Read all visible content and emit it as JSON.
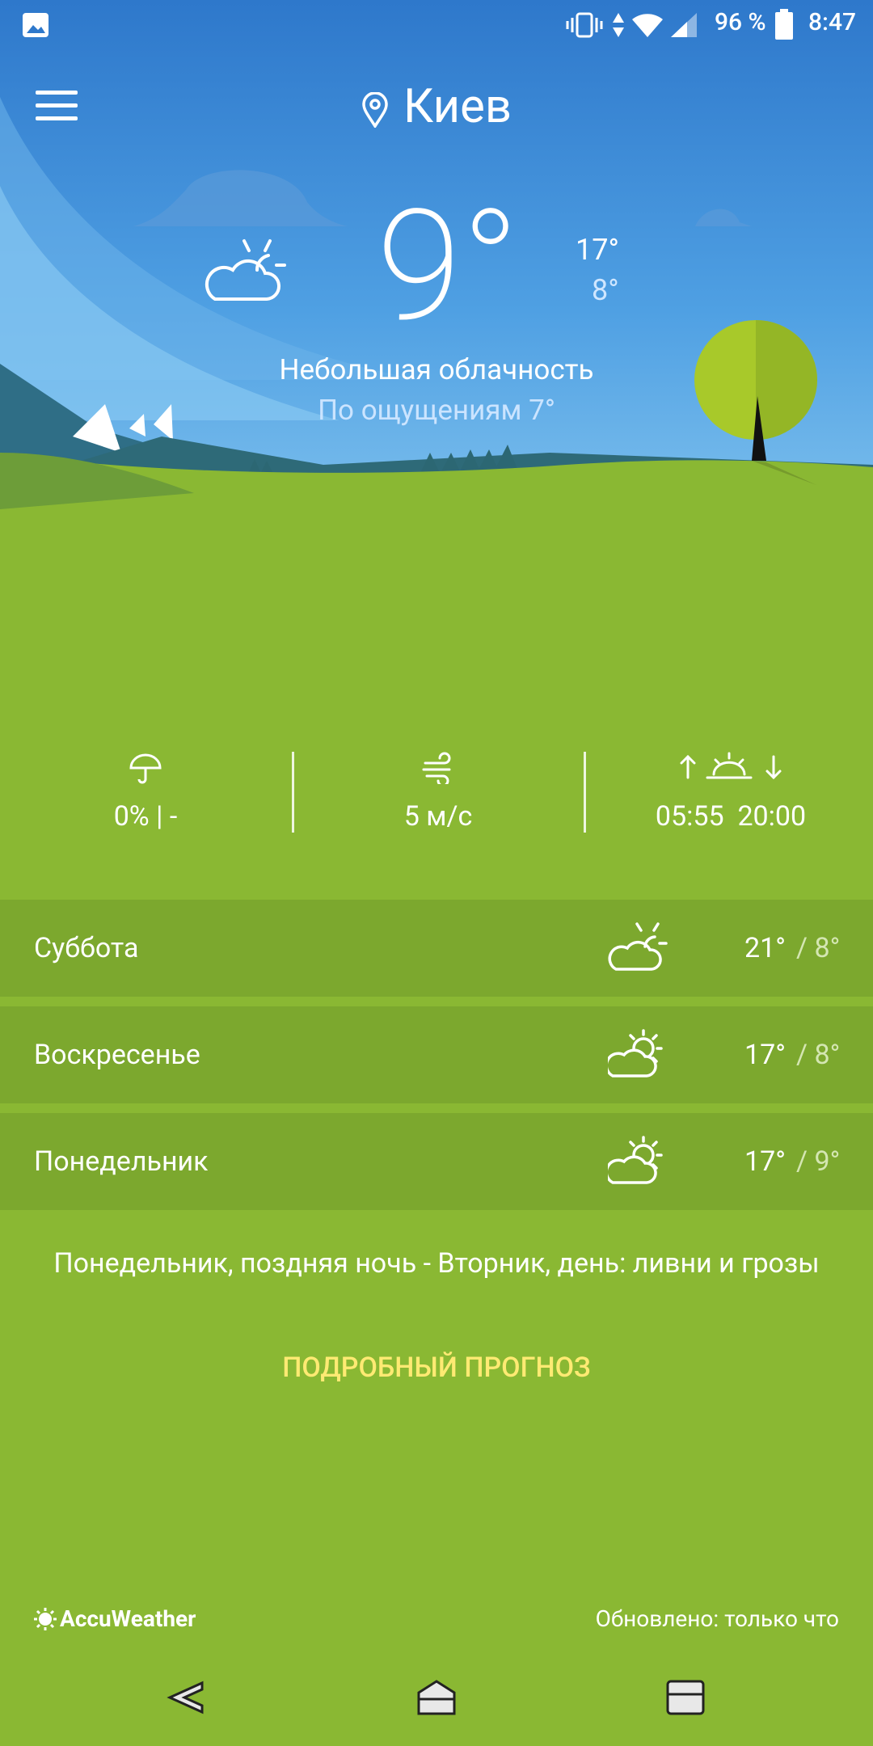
{
  "status_bar": {
    "battery_percent": "96 %",
    "time": "8:47"
  },
  "header": {
    "city": "Киев"
  },
  "current": {
    "temperature": "9°",
    "high": "17°",
    "low": "8°",
    "condition": "Небольшая облачность",
    "feels_like": "По ощущениям 7°"
  },
  "stats": {
    "precipitation": "0% | -",
    "wind": "5 м/с",
    "sunrise": "05:55",
    "sunset": "20:00"
  },
  "forecast": [
    {
      "day": "Суббота",
      "high": "21°",
      "low": " / 8°",
      "icon": "cloud-sun-icon"
    },
    {
      "day": "Воскресенье",
      "high": "17°",
      "low": " / 8°",
      "icon": "partly-sunny-icon"
    },
    {
      "day": "Понедельник",
      "high": "17°",
      "low": " / 9°",
      "icon": "partly-sunny-icon"
    }
  ],
  "outlook": "Понедельник, поздняя ночь - Вторник, день: ливни и грозы",
  "detail_link": "ПОДРОБНЫЙ ПРОГНОЗ",
  "footer": {
    "brand": "AccuWeather",
    "updated": "Обновлено: только что"
  },
  "colors": {
    "sky": "#3d8bd6",
    "grass": "#8ab833",
    "row": "#7ca82e",
    "link": "#ffea73"
  }
}
